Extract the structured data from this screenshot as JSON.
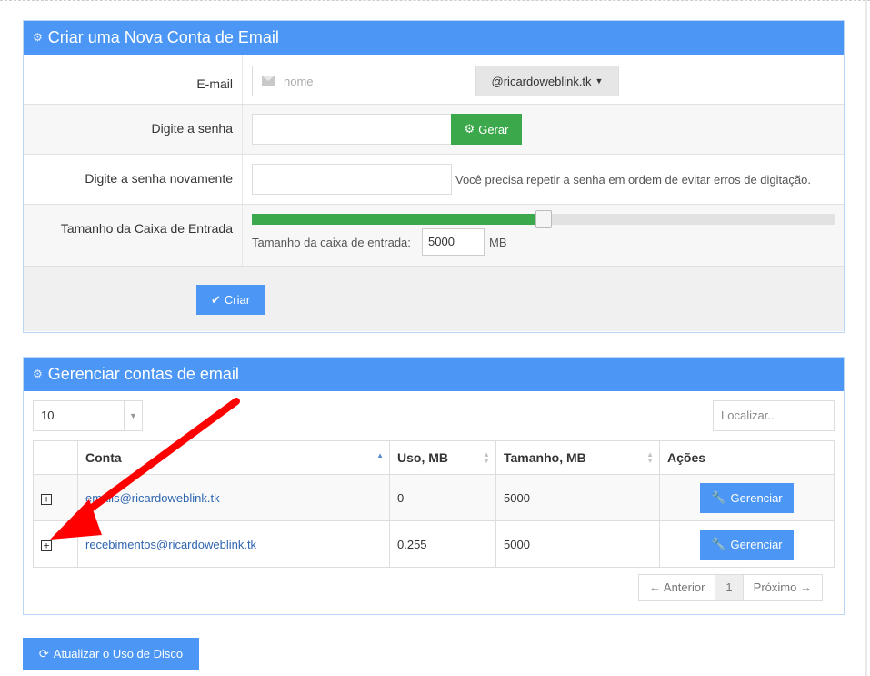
{
  "create": {
    "title": "Criar uma Nova Conta de Email",
    "email_label": "E-mail",
    "email_placeholder": "nome",
    "domain": "@ricardoweblink.tk",
    "password_label": "Digite a senha",
    "generate_label": "Gerar",
    "password_repeat_label": "Digite a senha novamente",
    "password_repeat_hint": "Você precisa repetir a senha em ordem de evitar erros de digitação.",
    "mailbox_label": "Tamanho da Caixa de Entrada",
    "mailbox_fraction": 0.5,
    "mailbox_field_label": "Tamanho da caixa de entrada:",
    "mailbox_value": "5000",
    "mailbox_unit": "MB",
    "create_label": "Criar"
  },
  "manage": {
    "title": "Gerenciar contas de email",
    "page_length": "10",
    "search_placeholder": "Localizar..",
    "columns": [
      "Conta",
      "Uso, MB",
      "Tamanho, MB",
      "Ações"
    ],
    "rows": [
      {
        "expand": "+",
        "account": "emails@ricardoweblink.tk",
        "usage": "0",
        "size": "5000",
        "action": "Gerenciar"
      },
      {
        "expand": "+",
        "account": "recebimentos@ricardoweblink.tk",
        "usage": "0.255",
        "size": "5000",
        "action": "Gerenciar"
      }
    ],
    "pagination": {
      "prev": "← Anterior",
      "current": "1",
      "next": "Próximo →"
    }
  },
  "update_disk_label": "Atualizar o Uso de Disco",
  "colors": {
    "primary": "#4c97f5",
    "success": "#3aa84b",
    "annotation_arrow": "#ff0000"
  },
  "icons": [
    "cogs-icon",
    "envelope-icon",
    "caret-down-icon",
    "gear-icon",
    "check-icon",
    "sort-icon",
    "plus-square-icon",
    "wrench-icon",
    "refresh-icon",
    "arrow-annotation"
  ]
}
